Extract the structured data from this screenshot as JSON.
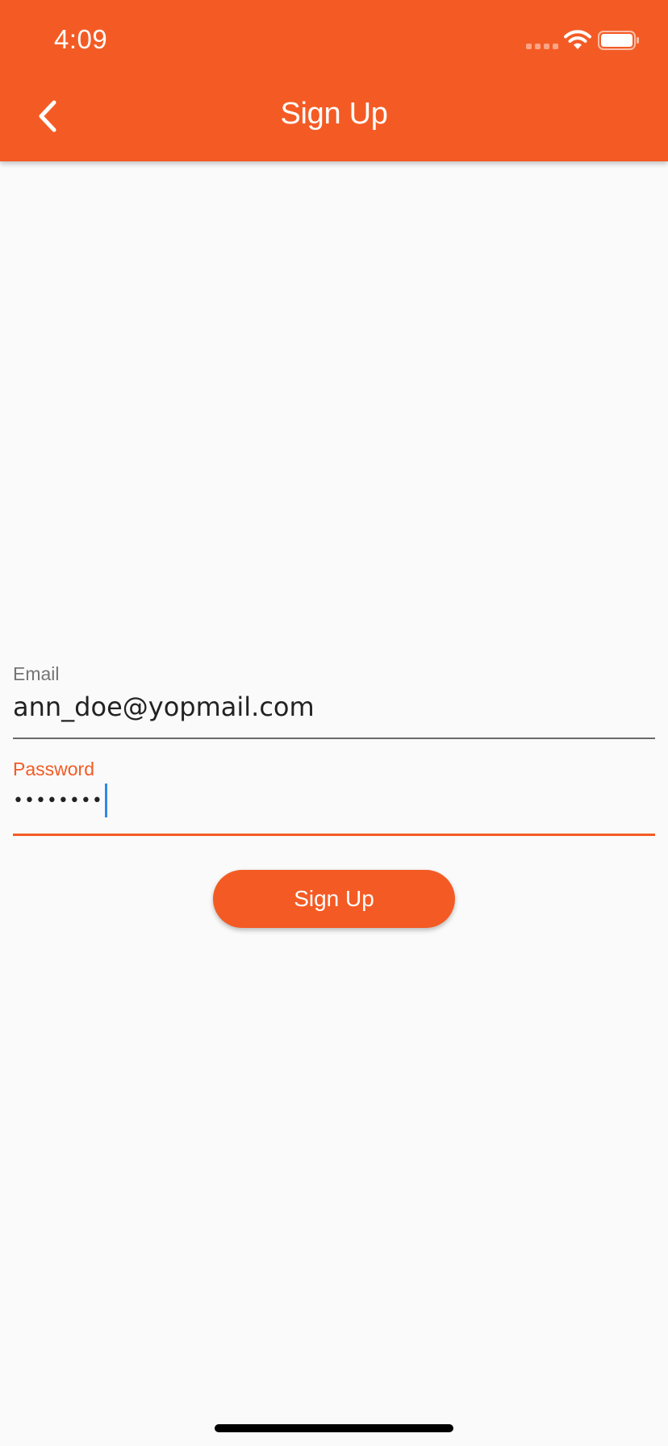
{
  "status_bar": {
    "time": "4:09"
  },
  "app_bar": {
    "title": "Sign Up",
    "back_icon": "chevron-left-icon"
  },
  "form": {
    "email": {
      "label": "Email",
      "value": "ann_doe@yopmail.com"
    },
    "password": {
      "label": "Password",
      "masked_value": "••••••••"
    },
    "submit_label": "Sign Up"
  },
  "colors": {
    "accent": "#f45b24",
    "background": "#fafafa",
    "caret": "#2f8be6"
  }
}
